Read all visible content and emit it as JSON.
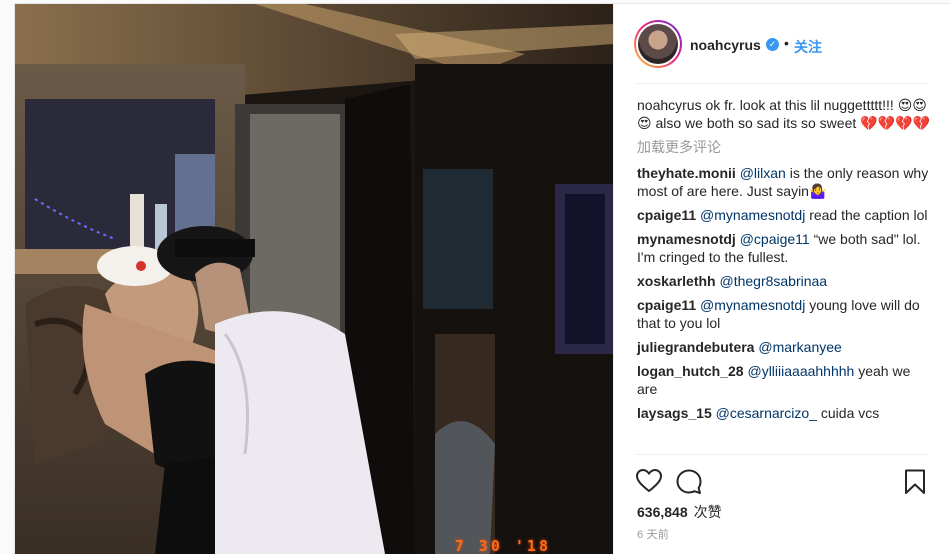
{
  "post": {
    "datestamp": "7 30 '18",
    "author": {
      "username": "noahcyrus",
      "follow_label": "关注"
    },
    "caption": {
      "username": "noahcyrus",
      "text": "ok fr. look at this lil nuggettttt!!! 😍😍😍 also we both so sad its so sweet 💔💔💔💔"
    },
    "load_more_label": "加载更多评论",
    "comments": [
      {
        "user": "theyhate.monii",
        "mention": "@lilxan",
        "text": " is the only reason why most of are here. Just sayin🤷‍♀️"
      },
      {
        "user": "cpaige11",
        "mention": "@mynamesnotdj",
        "text": " read the caption lol"
      },
      {
        "user": "mynamesnotdj",
        "mention": "@cpaige11",
        "text": " “we both sad\" lol. I'm cringed to the fullest."
      },
      {
        "user": "xoskarlethh",
        "mention": "@thegr8sabrinaa",
        "text": ""
      },
      {
        "user": "cpaige11",
        "mention": "@mynamesnotdj",
        "text": " young love will do that to you lol"
      },
      {
        "user": "juliegrandebutera",
        "mention": "@markanyee",
        "text": ""
      },
      {
        "user": "logan_hutch_28",
        "mention": "@ylliiiaaaahhhhh",
        "text": " yeah we are"
      },
      {
        "user": "laysags_15",
        "mention": "@cesarnarcizo_",
        "text": " cuida vcs"
      }
    ],
    "likes_count": "636,848",
    "likes_unit": "次赞",
    "time_ago": "6 天前",
    "icons": [
      "heart-icon",
      "comment-icon",
      "bookmark-icon",
      "verified-icon"
    ],
    "colors": {
      "link": "#003569",
      "follow": "#3897f0",
      "muted": "#999999"
    }
  }
}
